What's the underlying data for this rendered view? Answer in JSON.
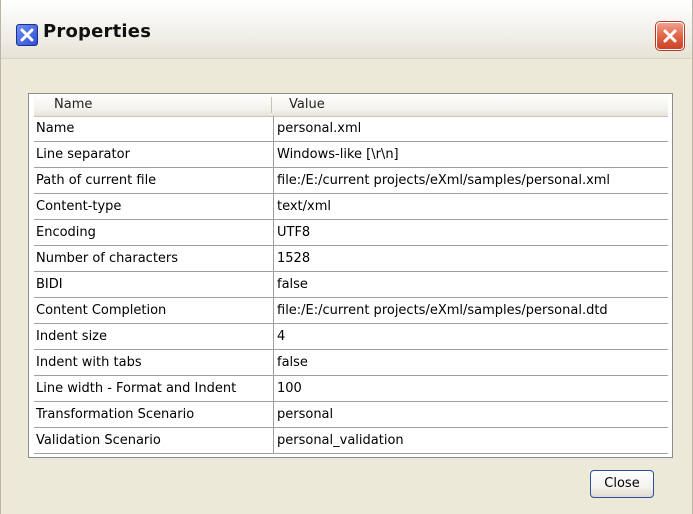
{
  "window": {
    "title": "Properties",
    "close_button_label": "Close"
  },
  "table": {
    "headers": [
      "Name",
      "Value"
    ],
    "rows": [
      [
        "Name",
        "personal.xml"
      ],
      [
        "Line separator",
        "Windows-like [\\r\\n]"
      ],
      [
        "Path of current file",
        "file:/E:/current projects/eXml/samples/personal.xml"
      ],
      [
        "Content-type",
        "text/xml"
      ],
      [
        "Encoding",
        "UTF8"
      ],
      [
        "Number of characters",
        "1528"
      ],
      [
        "BIDI",
        "false"
      ],
      [
        "Content Completion",
        "file:/E:/current projects/eXml/samples/personal.dtd"
      ],
      [
        "Indent size",
        "4"
      ],
      [
        "Indent with tabs",
        "false"
      ],
      [
        "Line width - Format and Indent",
        "100"
      ],
      [
        "Transformation Scenario",
        "personal"
      ],
      [
        "Validation Scenario",
        "personal_validation"
      ]
    ]
  },
  "icons": {
    "app": "app-x-icon",
    "close": "close-x-icon"
  },
  "colors": {
    "window_bg": "#ece9d8",
    "close_x": "#d9542f",
    "button_border": "#2b4fa2"
  }
}
